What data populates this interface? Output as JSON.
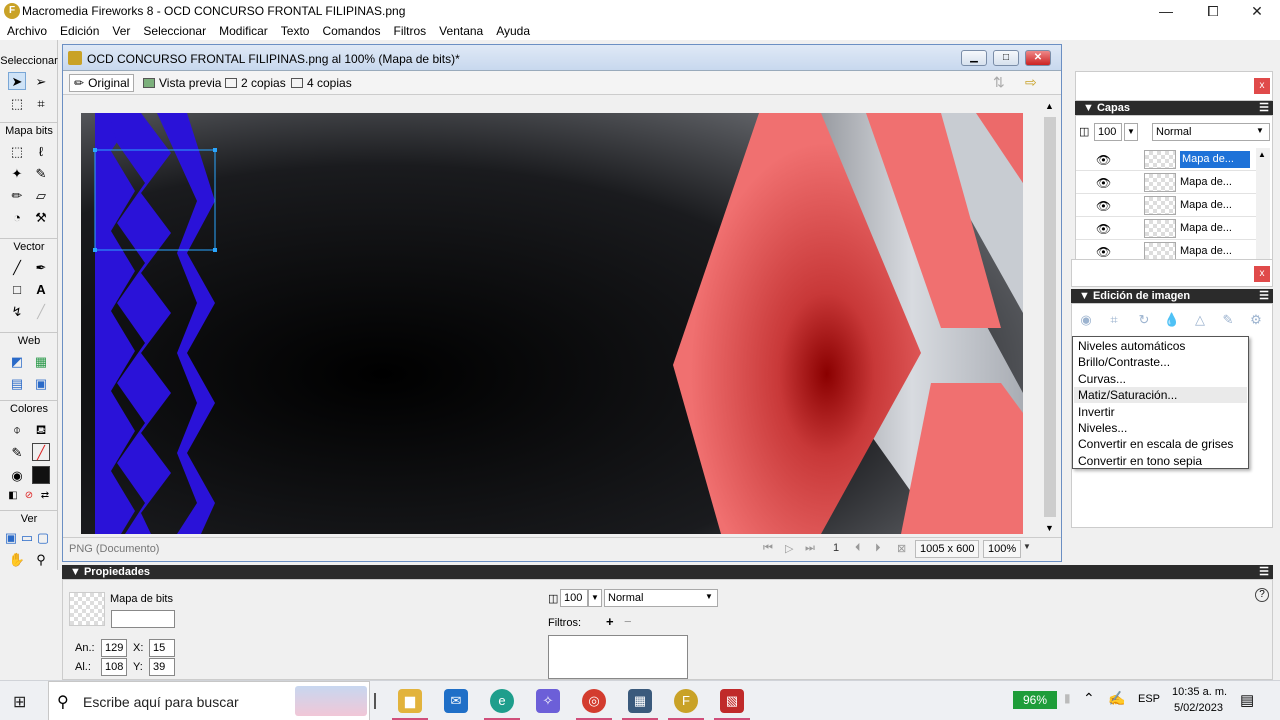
{
  "app": {
    "title": "Macromedia Fireworks 8 - OCD CONCURSO FRONTAL FILIPINAS.png",
    "icon": "fireworks-app-icon",
    "win_min": "—",
    "win_max": "⧠",
    "win_close": "✕"
  },
  "menu": [
    "Archivo",
    "Edición",
    "Ver",
    "Seleccionar",
    "Modificar",
    "Texto",
    "Comandos",
    "Filtros",
    "Ventana",
    "Ayuda"
  ],
  "tools": {
    "sections": [
      "Seleccionar",
      "Mapa bits",
      "Vector",
      "Web",
      "Colores",
      "Ver"
    ]
  },
  "document": {
    "title": "OCD CONCURSO FRONTAL FILIPINAS.png al 100% (Mapa de bits)*",
    "tabs": [
      "Original",
      "Vista previa",
      "2 copias",
      "4 copias"
    ],
    "status_info": "PNG (Documento)",
    "frame": "1",
    "size": "1005 x 600",
    "zoom": "100%"
  },
  "layers": {
    "header": "Capas",
    "opacity": "100",
    "blend": "Normal",
    "items": [
      "Mapa de...",
      "Mapa de...",
      "Mapa de...",
      "Mapa de...",
      "Mapa de..."
    ],
    "selected_index": 0
  },
  "image_edit": {
    "header": "Edición de imagen",
    "menu": [
      "Niveles automáticos",
      "Brillo/Contraste...",
      "Curvas...",
      "Matiz/Saturación...",
      "Invertir",
      "Niveles...",
      "Convertir en escala de grises",
      "Convertir en tono sepia"
    ],
    "hover_index": 3
  },
  "properties": {
    "header": "Propiedades",
    "type_label": "Mapa de bits",
    "name_value": "",
    "w_label": "An.:",
    "w_value": "129",
    "h_label": "Al.:",
    "h_value": "108",
    "x_label": "X:",
    "x_value": "15",
    "y_label": "Y:",
    "y_value": "39",
    "opacity": "100",
    "blend": "Normal",
    "filters_label": "Filtros:",
    "help": "?"
  },
  "taskbar": {
    "search_placeholder": "Escribe aquí para buscar",
    "battery": "96%",
    "lang": "ESP",
    "time": "10:35 a. m.",
    "date": "5/02/2023"
  },
  "colors": {
    "accent_blue": "#1e72d8",
    "canvas_red": "#f07070",
    "canvas_blue": "#2a12d8",
    "battery_green": "#1f9d3a"
  }
}
